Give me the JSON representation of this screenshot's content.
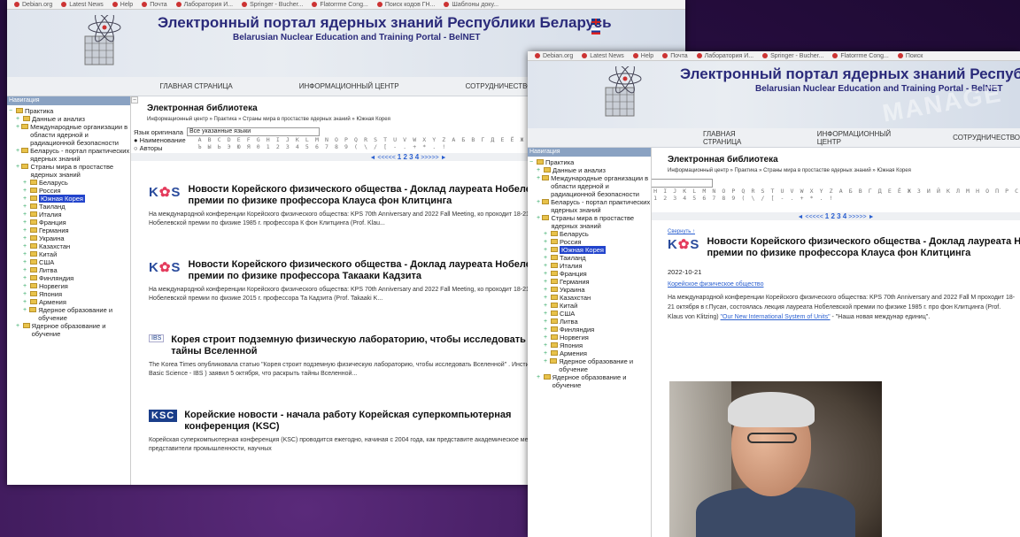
{
  "bookmarks": [
    "Debian.org",
    "Latest News",
    "Help",
    "Почта",
    "Лаборатория И...",
    "Springer - Bucher...",
    "Flatorrme Cong...",
    "Поиск кодов ГН...",
    "Шаблоны доку..."
  ],
  "bookmarks_right": [
    "Debian.org",
    "Latest News",
    "Help",
    "Почта",
    "Лаборатория И...",
    "Springer - Bucher...",
    "Flatorrme Cong...",
    "Поиск"
  ],
  "site": {
    "title": "Электронный портал ядерных знаний Республики Беларусь",
    "title_right": "Электронный портал ядерных знаний Республики",
    "subtitle": "Belarusian Nuclear Education and Training Portal - BelNET",
    "watermark": "MANAGE"
  },
  "nav": [
    "ГЛАВНАЯ СТРАНИЦА",
    "ИНФОРМАЦИОННЫЙ ЦЕНТР",
    "СОТРУДНИЧЕСТВО"
  ],
  "sidebar": {
    "header": "Навигация",
    "tree": [
      {
        "label": "Практика",
        "level": 0
      },
      {
        "label": "Данные и анализ",
        "level": 1
      },
      {
        "label": "Международные организации в области ядерной и радиационной безопасности",
        "level": 1
      },
      {
        "label": "Беларусь - портал практических ядерных знаний",
        "level": 1
      },
      {
        "label": "Страны мира в простастве ядерных знаний",
        "level": 1
      },
      {
        "label": "Беларусь",
        "level": 2
      },
      {
        "label": "Россия",
        "level": 2
      },
      {
        "label": "Южная Корея",
        "level": 2,
        "selected": true
      },
      {
        "label": "Таиланд",
        "level": 2
      },
      {
        "label": "Италия",
        "level": 2
      },
      {
        "label": "Франция",
        "level": 2
      },
      {
        "label": "Германия",
        "level": 2
      },
      {
        "label": "Украина",
        "level": 2
      },
      {
        "label": "Казахстан",
        "level": 2
      },
      {
        "label": "Китай",
        "level": 2
      },
      {
        "label": "США",
        "level": 2
      },
      {
        "label": "Литва",
        "level": 2
      },
      {
        "label": "Финляндия",
        "level": 2
      },
      {
        "label": "Норвегия",
        "level": 2
      },
      {
        "label": "Япония",
        "level": 2
      },
      {
        "label": "Армения",
        "level": 2
      },
      {
        "label": "Ядерное образование и обучение",
        "level": 2
      },
      {
        "label": "Ядерное образование и обучение",
        "level": 1
      }
    ]
  },
  "library": {
    "title": "Электронная библиотека",
    "breadcrumb": "Информационный центр » Практика » Страны мира в простастве ядерных знаний » Южная Корея",
    "lang_label": "Язык оригинала",
    "lang_value": "Все указанные языки",
    "radio_name": "Наименование",
    "radio_authors": "Авторы",
    "alpha_row1": "A B C D E F G H I J K L M N O P Q R S T U V W X Y Z А Б В Г Д Е Ё Ж З И Й К Л М Н О П Р С Т У Ф",
    "alpha_row2": "Ъ Ы Ь Э Ю Я 0 1 2 3 4 5 6 7 8 9 ( \\ / [ - . + * . !",
    "pager_prev": "◄ <<<<<",
    "pager_pages": "1 2 3 4",
    "pager_next": ">>>>> ►"
  },
  "articles": [
    {
      "logo": "KPS",
      "title1": "Новости Корейского физического общества - Доклад лауреата Нобелевск",
      "title2": "премии по физике профессора Клауса фон Клитцинга",
      "text": "На международной конференции Корейского физического общества: KPS 70th Anniversary and 2022 Fall Meeting, ко проходит 18-21 октября в г.Пусан, состоялась лекция лауреата Нобелевской премии по физике 1985 г. профессора К фон Клитцинга (Prof. Klau...",
      "more": "Подро"
    },
    {
      "logo": "KPS",
      "title1": "Новости Корейского физического общества - Доклад лауреата Нобелевск",
      "title2": "премии по физике профессора Такааки Кадзита",
      "text": "На международной конференции Корейского физического общества: KPS 70th Anniversary and 2022 Fall Meeting, ко проходит 18-21 октября в г.Пусан, состоялась лекция лауреата Нобелевской премии по физике 2015 г. профессора Та Кадзита (Prof. Takaaki K...",
      "more": "Подро"
    },
    {
      "logo": "IBS",
      "title1": "Корея строит подземную физическую лабораторию, чтобы исследовать",
      "title2": "тайны Вселенной",
      "text": "The Korea Times опубликовала статью \"Корея строит подземную физическую лабораторию, чтобы исследовать Вселенной\" . Институт фундаментальных наук Кореи ( the Institute of Basic Science - IBS ) заявил 5 октября, что раскрыть тайны Вселенной...",
      "more": "Подро"
    },
    {
      "logo": "KSC",
      "title1": "Корейские новости - начала работу Корейская суперкомпьютерная",
      "title2": "конференция (KSC)",
      "text": "Корейская суперкомпьютерная конференция (KSC) проводится ежегодно, начиная с 2004 года, как представите академическое мероприятие в Корее, в котором участвуют представители промышленности, научных",
      "more": ""
    }
  ],
  "detail": {
    "collapse_link": "Свернуть ↑",
    "title1": "Новости Корейского физического общества - Доклад лауреата Ноб",
    "title2": "премии по физике профессора Клауса фон Клитцинга",
    "date": "2022-10-21",
    "source": "Корейское физическое общество",
    "text_a": "На международной конференции Корейского физического общества: KPS 70th Anniversary and 2022 Fall M проходит 18-21 октября в г.Пусан, состоялась лекция лауреата Нобелевской премии по физике 1985 г. про фон Клитцинга (Prof. Klaus von Klitzing)",
    "text_link": "\"Our New International System of Units\"",
    "text_b": "- \"Наша новая междунар единиц\"."
  }
}
